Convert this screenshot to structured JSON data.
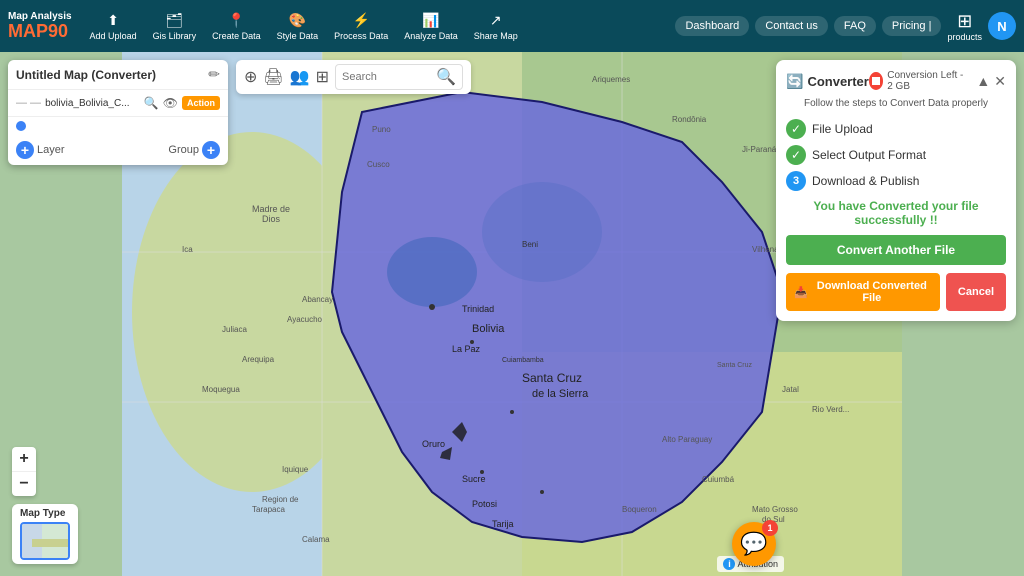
{
  "brand": {
    "app_name": "Map Analysis",
    "logo_text": "MAP",
    "logo_accent": "90"
  },
  "nav": {
    "items": [
      {
        "id": "add-upload",
        "icon": "⬆",
        "label": "Add Upload"
      },
      {
        "id": "gis-library",
        "icon": "🗂",
        "label": "Gis Library"
      },
      {
        "id": "create-data",
        "icon": "📍",
        "label": "Create Data"
      },
      {
        "id": "style-data",
        "icon": "🎨",
        "label": "Style Data"
      },
      {
        "id": "process-data",
        "icon": "⚡",
        "label": "Process Data"
      },
      {
        "id": "analyze-data",
        "icon": "📊",
        "label": "Analyze Data"
      },
      {
        "id": "share-map",
        "icon": "↗",
        "label": "Share Map"
      }
    ],
    "right_items": [
      "Dashboard",
      "Contact us",
      "FAQ",
      "Pricing |"
    ],
    "products_label": "products",
    "user_initial": "N"
  },
  "left_panel": {
    "title": "Untitled Map (Converter)",
    "layer_file": "bolivia_Bolivia_C...",
    "action_button": "Action",
    "layer_label": "Layer",
    "group_label": "Group"
  },
  "map_toolbar": {
    "search_placeholder": "Search"
  },
  "converter": {
    "title": "Converter",
    "subtitle": "Follow the steps to Convert Data properly",
    "conversion_left": "Conversion Left - 2 GB",
    "steps": [
      {
        "id": 1,
        "label": "File Upload",
        "done": true
      },
      {
        "id": 2,
        "label": "Select Output Format",
        "done": true
      },
      {
        "id": 3,
        "label": "Download & Publish",
        "done": false
      }
    ],
    "success_text": "You have Converted your file successfully !!",
    "convert_another_label": "Convert Another File",
    "download_label": "Download Converted File",
    "cancel_label": "Cancel"
  },
  "attribution": {
    "label": "Attribution"
  },
  "chat": {
    "badge_count": "1"
  },
  "zoom": {
    "plus": "+",
    "minus": "−"
  },
  "map_type_label": "Map Type"
}
